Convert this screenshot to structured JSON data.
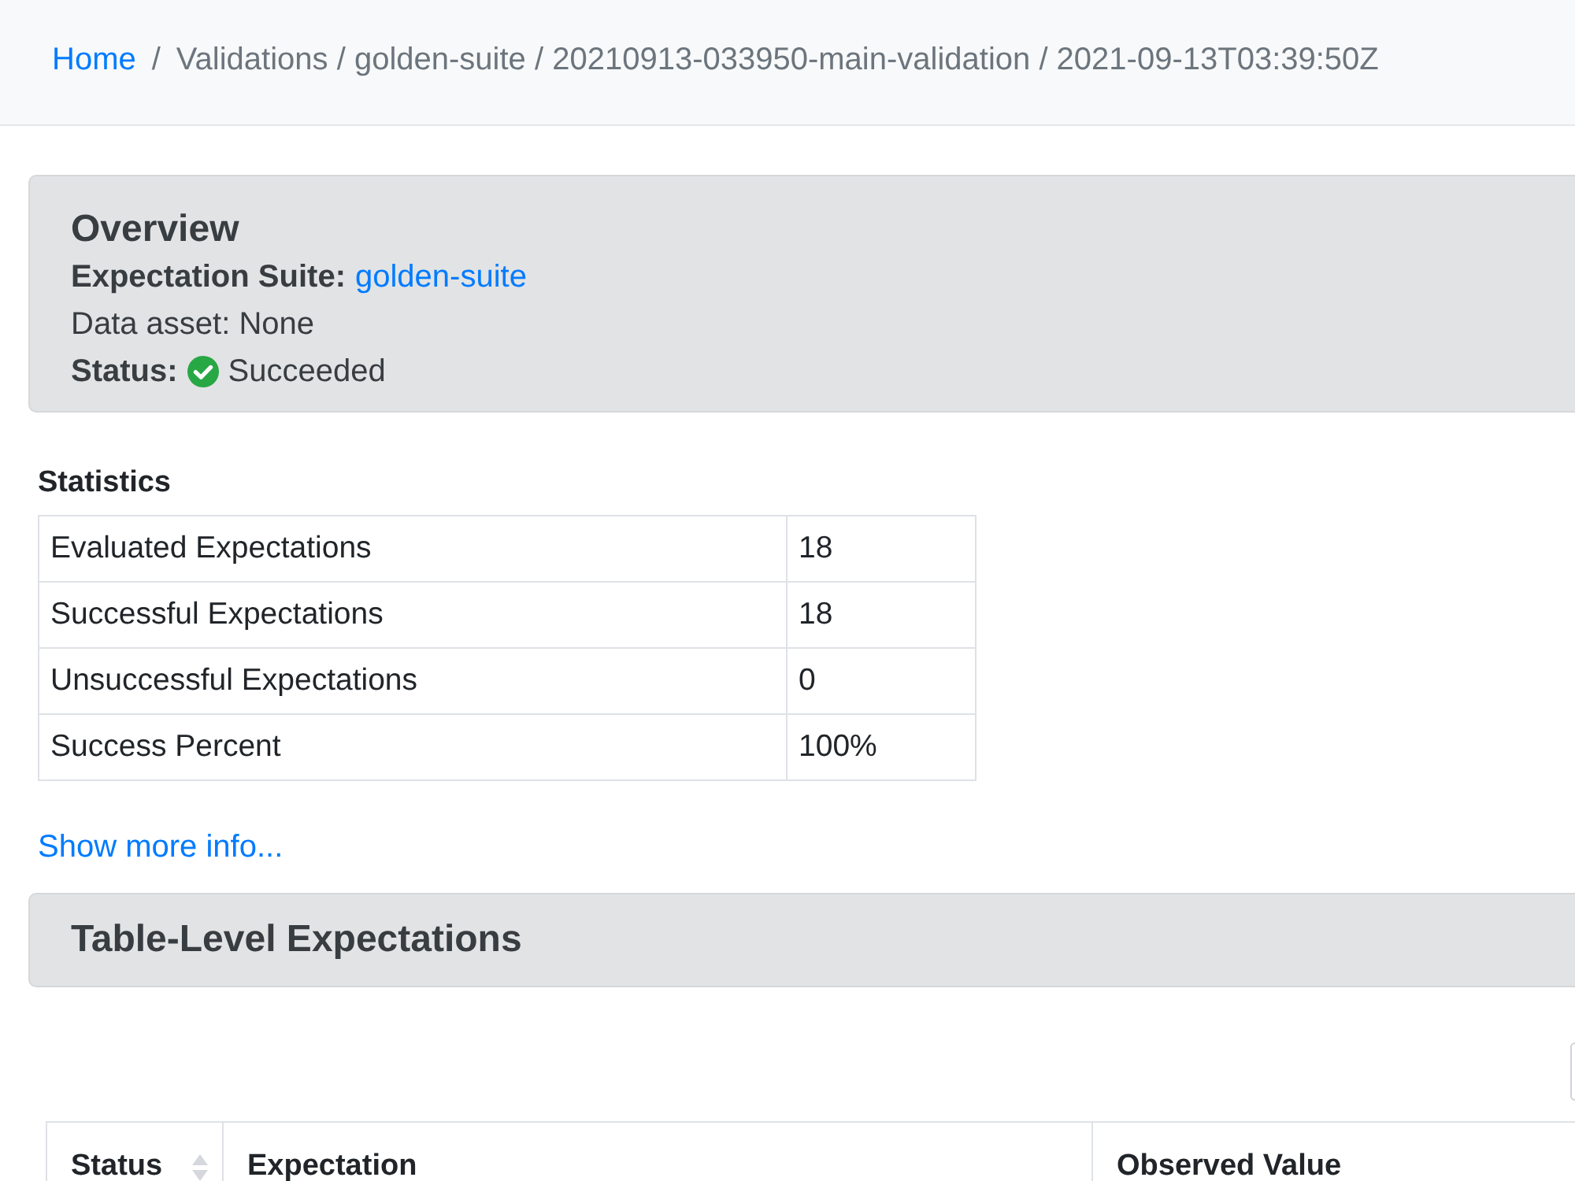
{
  "breadcrumb": {
    "separator": "/",
    "items": [
      {
        "label": "Home",
        "kind": "link"
      },
      {
        "label": "Validations / golden-suite / 20210913-033950-main-validation / 2021-09-13T03:39:50Z",
        "kind": "active"
      }
    ]
  },
  "overview": {
    "title": "Overview",
    "suite_label": "Expectation Suite:",
    "suite_link": "golden-suite",
    "data_asset": "Data asset: None",
    "status_label": "Status:",
    "status": {
      "kind": "success",
      "text": "Succeeded"
    }
  },
  "statistics": {
    "title": "Statistics",
    "rows": [
      {
        "label": "Evaluated Expectations",
        "value": "18"
      },
      {
        "label": "Successful Expectations",
        "value": "18"
      },
      {
        "label": "Unsuccessful Expectations",
        "value": "0"
      },
      {
        "label": "Success Percent",
        "value": "100%"
      }
    ]
  },
  "show_more": "Show more info...",
  "table_section": {
    "title": "Table-Level Expectations",
    "columns": [
      {
        "label": "Status",
        "sortable": true
      },
      {
        "label": "Expectation",
        "sortable": false
      },
      {
        "label": "Observed Value",
        "sortable": false
      }
    ]
  }
}
